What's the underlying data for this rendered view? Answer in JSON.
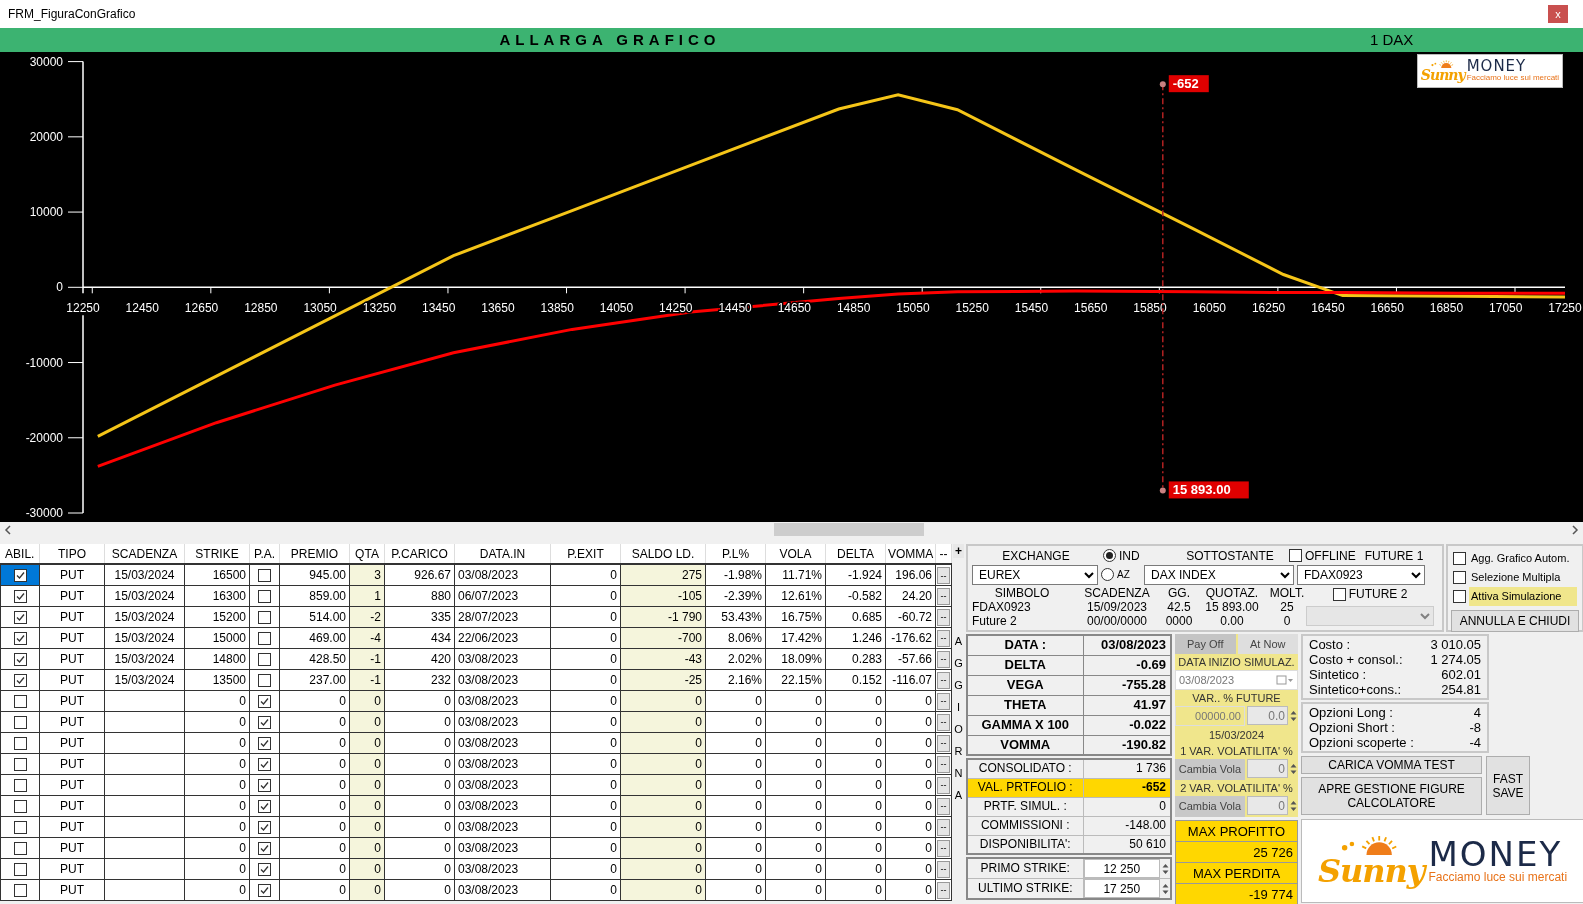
{
  "window": {
    "title": "FRM_FiguraConGrafico",
    "close": "x"
  },
  "header": {
    "button": "ALLARGA GRAFICO",
    "instrument": "1 DAX"
  },
  "chart": {
    "logo": {
      "script": "Sunny",
      "word": "MONEY",
      "tagline": "Facciamo luce sui mercati"
    },
    "chart_data": {
      "type": "line",
      "xlim": [
        12250,
        17250
      ],
      "ylim": [
        -30000,
        30000
      ],
      "xticks": [
        12250,
        12450,
        12650,
        12850,
        13050,
        13250,
        13450,
        13650,
        13850,
        14050,
        14250,
        14450,
        14650,
        14850,
        15050,
        15250,
        15450,
        15650,
        15850,
        16050,
        16250,
        16450,
        16650,
        16850,
        17050,
        17250
      ],
      "yticks": [
        -30000,
        -20000,
        -10000,
        0,
        10000,
        20000,
        30000
      ],
      "x": [
        12300,
        12700,
        13100,
        13500,
        13900,
        14300,
        14800,
        15000,
        15200,
        15600,
        16000,
        16300,
        16500,
        16900,
        17250
      ],
      "series": [
        {
          "color": "#f5c518",
          "values": [
            -19800,
            -11800,
            -3800,
            4200,
            10200,
            16200,
            23700,
            25600,
            23600,
            15600,
            7700,
            1700,
            -1100,
            -1200,
            -1300
          ]
        },
        {
          "color": "#ff0000",
          "values": [
            -23800,
            -18000,
            -13000,
            -8700,
            -5600,
            -3300,
            -1500,
            -900,
            -600,
            -500,
            -600,
            -700,
            -700,
            -800,
            -800
          ]
        }
      ],
      "ref_lines": [
        {
          "axis": "x",
          "value": 15893
        }
      ],
      "annotations": [
        {
          "x": 15893,
          "y": 27000,
          "text": "-652"
        },
        {
          "x": 15893,
          "y": -27000,
          "text": "15 893.00"
        }
      ]
    }
  },
  "table": {
    "columns": [
      {
        "label": "ABIL.",
        "kind": "check"
      },
      {
        "label": "TIPO",
        "kind": "text"
      },
      {
        "label": "SCADENZA",
        "kind": "text"
      },
      {
        "label": "STRIKE",
        "kind": "text"
      },
      {
        "label": "P.A.",
        "kind": "check"
      },
      {
        "label": "PREMIO",
        "kind": "text"
      },
      {
        "label": "QTA",
        "kind": "text",
        "shaded": true
      },
      {
        "label": "P.CARICO",
        "kind": "text"
      },
      {
        "label": "DATA.IN",
        "kind": "text"
      },
      {
        "label": "P.EXIT",
        "kind": "text"
      },
      {
        "label": "SALDO LD.",
        "kind": "text",
        "shaded": true
      },
      {
        "label": "P.L%",
        "kind": "text"
      },
      {
        "label": "VOLA",
        "kind": "text"
      },
      {
        "label": "DELTA",
        "kind": "text"
      },
      {
        "label": "VOMMA",
        "kind": "text"
      },
      {
        "label": "--",
        "kind": "button"
      }
    ],
    "rows": [
      {
        "selected": true,
        "abil": true,
        "tipo": "PUT",
        "scadenza": "15/03/2024",
        "strike": "16500",
        "pa": false,
        "premio": "945.00",
        "qta": "3",
        "p_carico": "926.67",
        "data_in": "03/08/2023",
        "p_exit": "0",
        "saldo_ld": "275",
        "pl": "-1.98%",
        "vola": "11.71%",
        "delta": "-1.924",
        "vomma": "196.06",
        "action": "--"
      },
      {
        "selected": false,
        "abil": true,
        "tipo": "PUT",
        "scadenza": "15/03/2024",
        "strike": "16300",
        "pa": false,
        "premio": "859.00",
        "qta": "1",
        "p_carico": "880",
        "data_in": "06/07/2023",
        "p_exit": "0",
        "saldo_ld": "-105",
        "pl": "-2.39%",
        "vola": "12.61%",
        "delta": "-0.582",
        "vomma": "24.20",
        "action": "--"
      },
      {
        "selected": false,
        "abil": true,
        "tipo": "PUT",
        "scadenza": "15/03/2024",
        "strike": "15200",
        "pa": false,
        "premio": "514.00",
        "qta": "-2",
        "p_carico": "335",
        "data_in": "28/07/2023",
        "p_exit": "0",
        "saldo_ld": "-1 790",
        "pl": "53.43%",
        "vola": "16.75%",
        "delta": "0.685",
        "vomma": "-60.72",
        "action": "--"
      },
      {
        "selected": false,
        "abil": true,
        "tipo": "PUT",
        "scadenza": "15/03/2024",
        "strike": "15000",
        "pa": false,
        "premio": "469.00",
        "qta": "-4",
        "p_carico": "434",
        "data_in": "22/06/2023",
        "p_exit": "0",
        "saldo_ld": "-700",
        "pl": "8.06%",
        "vola": "17.42%",
        "delta": "1.246",
        "vomma": "-176.62",
        "action": "--"
      },
      {
        "selected": false,
        "abil": true,
        "tipo": "PUT",
        "scadenza": "15/03/2024",
        "strike": "14800",
        "pa": false,
        "premio": "428.50",
        "qta": "-1",
        "p_carico": "420",
        "data_in": "03/08/2023",
        "p_exit": "0",
        "saldo_ld": "-43",
        "pl": "2.02%",
        "vola": "18.09%",
        "delta": "0.283",
        "vomma": "-57.66",
        "action": "--"
      },
      {
        "selected": false,
        "abil": true,
        "tipo": "PUT",
        "scadenza": "15/03/2024",
        "strike": "13500",
        "pa": false,
        "premio": "237.00",
        "qta": "-1",
        "p_carico": "232",
        "data_in": "03/08/2023",
        "p_exit": "0",
        "saldo_ld": "-25",
        "pl": "2.16%",
        "vola": "22.15%",
        "delta": "0.152",
        "vomma": "-116.07",
        "action": "--"
      },
      {
        "selected": false,
        "abil": false,
        "tipo": "PUT",
        "strike": "0",
        "pa": true,
        "premio": "0",
        "qta": "0",
        "p_carico": "0",
        "data_in": "03/08/2023",
        "p_exit": "0",
        "saldo_ld": "0",
        "pl": "0",
        "vola": "0",
        "delta": "0",
        "vomma": "0",
        "action": "--"
      },
      {
        "selected": false,
        "abil": false,
        "tipo": "PUT",
        "strike": "0",
        "pa": true,
        "premio": "0",
        "qta": "0",
        "p_carico": "0",
        "data_in": "03/08/2023",
        "p_exit": "0",
        "saldo_ld": "0",
        "pl": "0",
        "vola": "0",
        "delta": "0",
        "vomma": "0",
        "action": "--"
      },
      {
        "selected": false,
        "abil": false,
        "tipo": "PUT",
        "strike": "0",
        "pa": true,
        "premio": "0",
        "qta": "0",
        "p_carico": "0",
        "data_in": "03/08/2023",
        "p_exit": "0",
        "saldo_ld": "0",
        "pl": "0",
        "vola": "0",
        "delta": "0",
        "vomma": "0",
        "action": "--"
      },
      {
        "selected": false,
        "abil": false,
        "tipo": "PUT",
        "strike": "0",
        "pa": true,
        "premio": "0",
        "qta": "0",
        "p_carico": "0",
        "data_in": "03/08/2023",
        "p_exit": "0",
        "saldo_ld": "0",
        "pl": "0",
        "vola": "0",
        "delta": "0",
        "vomma": "0",
        "action": "--"
      },
      {
        "selected": false,
        "abil": false,
        "tipo": "PUT",
        "strike": "0",
        "pa": true,
        "premio": "0",
        "qta": "0",
        "p_carico": "0",
        "data_in": "03/08/2023",
        "p_exit": "0",
        "saldo_ld": "0",
        "pl": "0",
        "vola": "0",
        "delta": "0",
        "vomma": "0",
        "action": "--"
      },
      {
        "selected": false,
        "abil": false,
        "tipo": "PUT",
        "strike": "0",
        "pa": true,
        "premio": "0",
        "qta": "0",
        "p_carico": "0",
        "data_in": "03/08/2023",
        "p_exit": "0",
        "saldo_ld": "0",
        "pl": "0",
        "vola": "0",
        "delta": "0",
        "vomma": "0",
        "action": "--"
      },
      {
        "selected": false,
        "abil": false,
        "tipo": "PUT",
        "strike": "0",
        "pa": true,
        "premio": "0",
        "qta": "0",
        "p_carico": "0",
        "data_in": "03/08/2023",
        "p_exit": "0",
        "saldo_ld": "0",
        "pl": "0",
        "vola": "0",
        "delta": "0",
        "vomma": "0",
        "action": "--"
      },
      {
        "selected": false,
        "abil": false,
        "tipo": "PUT",
        "strike": "0",
        "pa": true,
        "premio": "0",
        "qta": "0",
        "p_carico": "0",
        "data_in": "03/08/2023",
        "p_exit": "0",
        "saldo_ld": "0",
        "pl": "0",
        "vola": "0",
        "delta": "0",
        "vomma": "0",
        "action": "--"
      },
      {
        "selected": false,
        "abil": false,
        "tipo": "PUT",
        "strike": "0",
        "pa": true,
        "premio": "0",
        "qta": "0",
        "p_carico": "0",
        "data_in": "03/08/2023",
        "p_exit": "0",
        "saldo_ld": "0",
        "pl": "0",
        "vola": "0",
        "delta": "0",
        "vomma": "0",
        "action": "--"
      },
      {
        "selected": false,
        "abil": false,
        "tipo": "PUT",
        "strike": "0",
        "pa": true,
        "premio": "0",
        "qta": "0",
        "p_carico": "0",
        "data_in": "03/08/2023",
        "p_exit": "0",
        "saldo_ld": "0",
        "pl": "0",
        "vola": "0",
        "delta": "0",
        "vomma": "0",
        "action": "--"
      }
    ]
  },
  "add_button": "+",
  "update_button": "AGGIORNA",
  "market": {
    "exchange_label": "EXCHANGE",
    "exchange": "EUREX",
    "type_options": [
      {
        "label": "IND",
        "selected": true
      },
      {
        "label": "AZ",
        "selected": false
      }
    ],
    "underlying_label": "SOTTOSTANTE",
    "underlying": "DAX INDEX",
    "offline": {
      "label": "OFFLINE",
      "checked": false
    },
    "future1_label": "FUTURE 1",
    "future1": "FDAX0923",
    "future2": {
      "label": "FUTURE 2",
      "checked": false,
      "disabled": true
    },
    "info_columns": [
      "SIMBOLO",
      "SCADENZA",
      "GG.",
      "QUOTAZ.",
      "MOLT."
    ],
    "info_rows": [
      [
        "FDAX0923",
        "15/09/2023",
        "42.5",
        "15 893.00",
        "25"
      ],
      [
        "Future 2",
        "00/00/0000",
        "0000",
        "0.00",
        "0"
      ]
    ]
  },
  "options": {
    "checkboxes": [
      {
        "label": "Agg. Grafico Autom.",
        "checked": false,
        "highlighted": false
      },
      {
        "label": "Selezione Multipla",
        "checked": false,
        "highlighted": false
      },
      {
        "label": "Attiva Simulazione",
        "checked": false,
        "highlighted": true
      }
    ],
    "close_button": "ANNULLA E CHIUDI"
  },
  "greeks": [
    {
      "label": "DATA :",
      "value": "03/08/2023"
    },
    {
      "label": "DELTA",
      "value": "-0.69"
    },
    {
      "label": "VEGA",
      "value": "-755.28"
    },
    {
      "label": "THETA",
      "value": "41.97"
    },
    {
      "label": "GAMMA X 100",
      "value": "-0.022"
    },
    {
      "label": "VOMMA",
      "value": "-190.82"
    }
  ],
  "portfolio": [
    {
      "label": "CONSOLIDATO :",
      "value": "1 736",
      "highlighted": false
    },
    {
      "label": "VAL. PRTFOLIO :",
      "value": "-652",
      "highlighted": true
    },
    {
      "label": "PRTF. SIMUL. :",
      "value": "0",
      "highlighted": false
    },
    {
      "label": "COMMISSIONI :",
      "value": "-148.00",
      "highlighted": false
    },
    {
      "label": "DISPONIBILITA':",
      "value": "50 610",
      "highlighted": false
    }
  ],
  "strikes": [
    {
      "label": "PRIMO STRIKE:",
      "value": "12 250"
    },
    {
      "label": "ULTIMO STRIKE:",
      "value": "17 250"
    }
  ],
  "simulation": {
    "disabled": true,
    "tabs": [
      {
        "label": "Pay Off",
        "selected": true
      },
      {
        "label": "At Now",
        "selected": false
      }
    ],
    "start_label": "DATA INIZIO SIMULAZ.",
    "start_date": "03/08/2023",
    "future_label": "VAR.. % FUTURE",
    "future_value": "00000.00",
    "future_step": "0.0",
    "expiry": "15/03/2024",
    "vol_rows": [
      {
        "label": "1 VAR. VOLATILITA' %",
        "button": "Cambia Vola",
        "value": "0"
      },
      {
        "label": "2 VAR. VOLATILITA' %",
        "button": "Cambia Vola",
        "value": "0"
      }
    ]
  },
  "extremes": [
    {
      "label": "MAX PROFITTO",
      "value": "25 726"
    },
    {
      "label": "MAX PERDITA",
      "value": "-19 774"
    }
  ],
  "costs": [
    {
      "label": "Costo :",
      "value": "3 010.05"
    },
    {
      "label": "Costo + consol.:",
      "value": "1 274.05"
    },
    {
      "label": "Sintetico :",
      "value": "602.01"
    },
    {
      "label": "Sintetico+cons.:",
      "value": "254.81"
    }
  ],
  "counts": [
    {
      "label": "Opzioni Long :",
      "value": "4"
    },
    {
      "label": "Opzioni Short :",
      "value": "-8"
    },
    {
      "label": "Opzioni scoperte :",
      "value": "-4"
    }
  ],
  "buttons": {
    "vomma_test": "CARICA VOMMA TEST",
    "figures": "APRE GESTIONE FIGURE CALCOLATORE",
    "fast_save": "FAST SAVE"
  },
  "logo": {
    "script": "Sunny",
    "word": "MONEY",
    "tagline": "Facciamo luce sui mercati"
  }
}
